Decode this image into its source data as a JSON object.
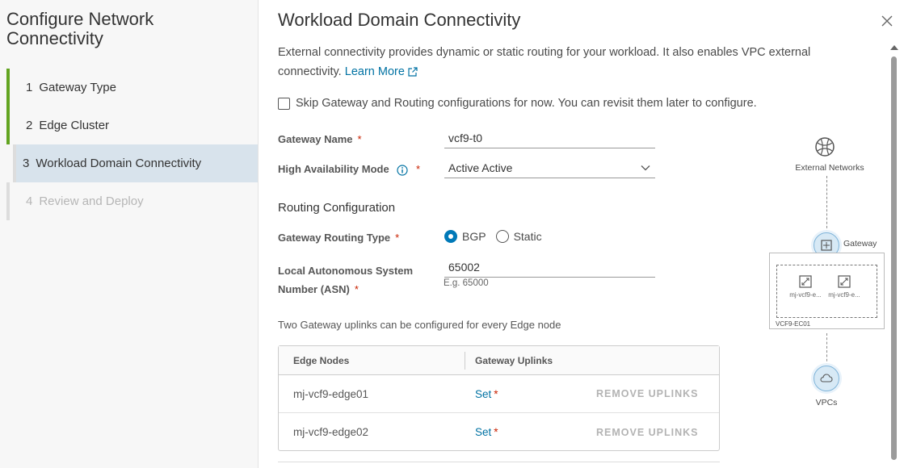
{
  "wizard": {
    "title": "Configure Network Connectivity",
    "steps": [
      {
        "num": "1",
        "label": "Gateway Type",
        "state": "done"
      },
      {
        "num": "2",
        "label": "Edge Cluster",
        "state": "done"
      },
      {
        "num": "3",
        "label": "Workload Domain Connectivity",
        "state": "active"
      },
      {
        "num": "4",
        "label": "Review and Deploy",
        "state": "pending"
      }
    ]
  },
  "page": {
    "title": "Workload Domain Connectivity",
    "description": "External connectivity provides dynamic or static routing for your workload. It also enables VPC external connectivity.",
    "learn_more": "Learn More",
    "skip_label": "Skip Gateway and Routing configurations for now. You can revisit them later to configure."
  },
  "form": {
    "gateway_name_label": "Gateway Name",
    "gateway_name_value": "vcf9-t0",
    "ha_mode_label": "High Availability Mode",
    "ha_mode_value": "Active Active",
    "required_mark": "*",
    "routing_section_title": "Routing Configuration",
    "routing_type_label": "Gateway Routing Type",
    "routing_options": [
      "BGP",
      "Static"
    ],
    "routing_selected": "BGP",
    "asn_label_line1": "Local Autonomous System",
    "asn_label_line2": "Number (ASN)",
    "asn_value": "65002",
    "asn_helper": "E.g. 65000"
  },
  "uplinks": {
    "note": "Two Gateway uplinks can be configured for every Edge node",
    "columns": [
      "Edge Nodes",
      "Gateway Uplinks"
    ],
    "rows": [
      {
        "node": "mj-vcf9-edge01",
        "uplink": "Set",
        "action": "REMOVE UPLINKS"
      },
      {
        "node": "mj-vcf9-edge02",
        "uplink": "Set",
        "action": "REMOVE UPLINKS"
      }
    ]
  },
  "topology": {
    "external_label": "External Networks",
    "gateway_label": "Gateway",
    "cluster_label": "VCF9-EC01",
    "edge_labels": [
      "mj-vcf9-e...",
      "mj-vcf9-e..."
    ],
    "vpcs_label": "VPCs"
  },
  "colors": {
    "accent": "#0079b8",
    "link": "#0072a3",
    "step_done": "#62a420",
    "required": "#c92100"
  }
}
